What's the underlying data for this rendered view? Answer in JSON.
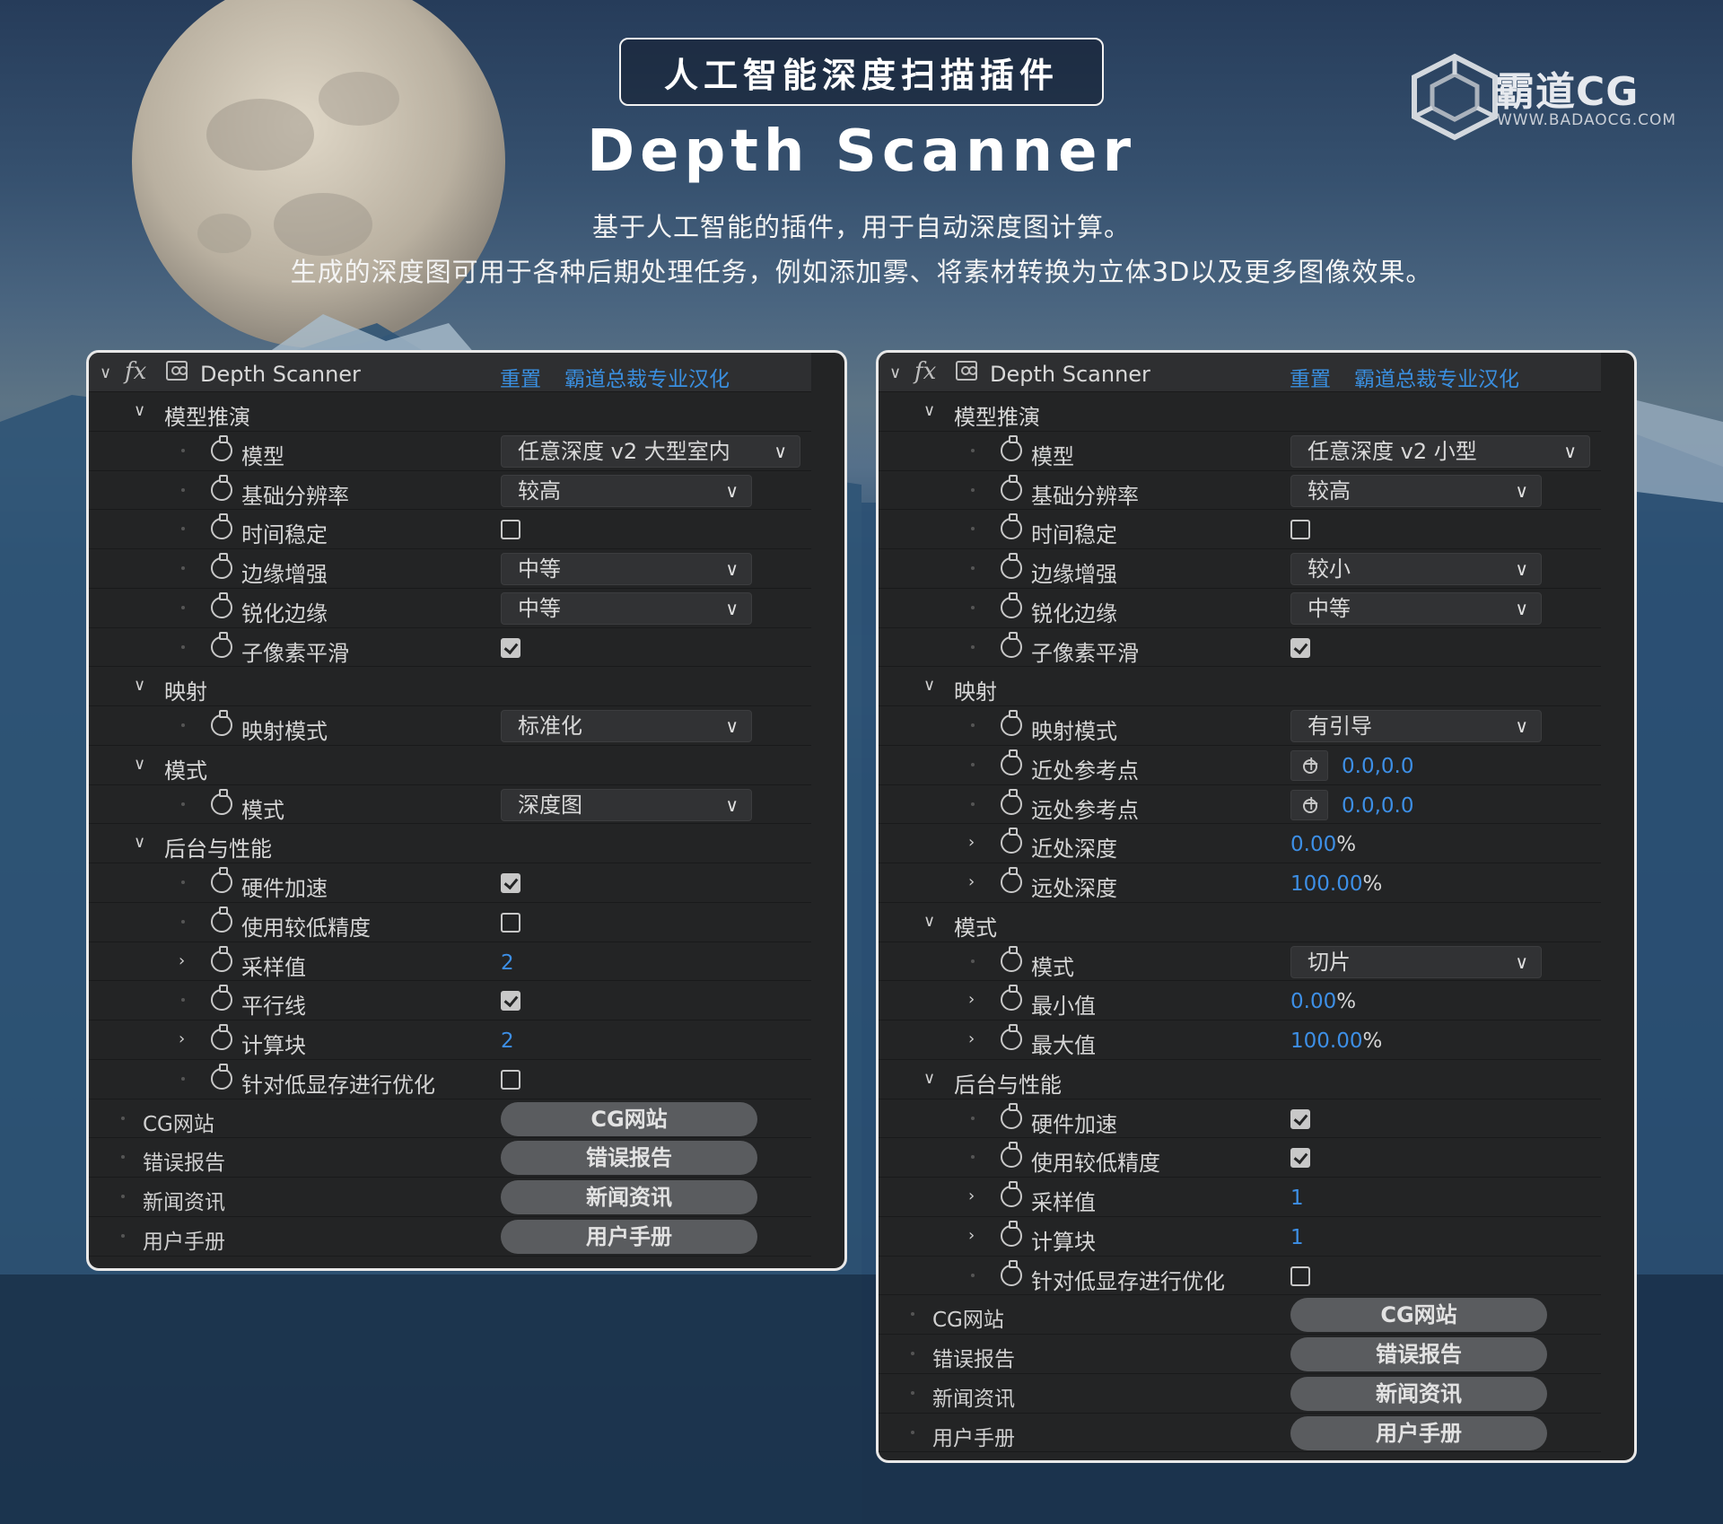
{
  "header": {
    "badge": "人工智能深度扫描插件",
    "title": "Depth Scanner",
    "subtitle_1": "基于人工智能的插件，用于自动深度图计算。",
    "subtitle_2": "生成的深度图可用于各种后期处理任务，例如添加雾、将素材转换为立体3D以及更多图像效果。"
  },
  "logo": {
    "name": "霸道CG",
    "url": "WWW.BADAOCG.COM"
  },
  "colors": {
    "accent_blue": "#3a8fe0",
    "panel_bg": "#232425",
    "button_bg": "#5a5c5f"
  },
  "left_panel": {
    "effect_name": "Depth Scanner",
    "reset": "重置",
    "localization": "霸道总裁专业汉化",
    "groups": {
      "model": "模型推演",
      "mapping": "映射",
      "mode": "模式",
      "backend": "后台与性能"
    },
    "params": {
      "model": {
        "label": "模型",
        "value": "任意深度 v2 大型室内"
      },
      "base_res": {
        "label": "基础分辨率",
        "value": "较高"
      },
      "temporal": {
        "label": "时间稳定",
        "checked": false
      },
      "edge_enhance": {
        "label": "边缘增强",
        "value": "中等"
      },
      "sharpen_edges": {
        "label": "锐化边缘",
        "value": "中等"
      },
      "subpixel": {
        "label": "子像素平滑",
        "checked": true
      },
      "map_mode": {
        "label": "映射模式",
        "value": "标准化"
      },
      "mode": {
        "label": "模式",
        "value": "深度图"
      },
      "hw_accel": {
        "label": "硬件加速",
        "checked": true
      },
      "low_precision": {
        "label": "使用较低精度",
        "checked": false
      },
      "samples": {
        "label": "采样值",
        "value": "2"
      },
      "parallel": {
        "label": "平行线",
        "checked": true
      },
      "tiles": {
        "label": "计算块",
        "value": "2"
      },
      "low_vram": {
        "label": "针对低显存进行优化",
        "checked": false
      }
    },
    "buttons": [
      {
        "label": "CG网站",
        "button": "CG网站"
      },
      {
        "label": "错误报告",
        "button": "错误报告"
      },
      {
        "label": "新闻资讯",
        "button": "新闻资讯"
      },
      {
        "label": "用户手册",
        "button": "用户手册"
      }
    ]
  },
  "right_panel": {
    "effect_name": "Depth Scanner",
    "reset": "重置",
    "localization": "霸道总裁专业汉化",
    "groups": {
      "model": "模型推演",
      "mapping": "映射",
      "mode": "模式",
      "backend": "后台与性能"
    },
    "params": {
      "model": {
        "label": "模型",
        "value": "任意深度 v2 小型"
      },
      "base_res": {
        "label": "基础分辨率",
        "value": "较高"
      },
      "temporal": {
        "label": "时间稳定",
        "checked": false
      },
      "edge_enhance": {
        "label": "边缘增强",
        "value": "较小"
      },
      "sharpen_edges": {
        "label": "锐化边缘",
        "value": "中等"
      },
      "subpixel": {
        "label": "子像素平滑",
        "checked": true
      },
      "map_mode": {
        "label": "映射模式",
        "value": "有引导"
      },
      "near_point": {
        "label": "近处参考点",
        "value": "0.0,0.0"
      },
      "far_point": {
        "label": "远处参考点",
        "value": "0.0,0.0"
      },
      "near_depth": {
        "label": "近处深度",
        "value": "0.00",
        "unit": "%"
      },
      "far_depth": {
        "label": "远处深度",
        "value": "100.00",
        "unit": "%"
      },
      "mode": {
        "label": "模式",
        "value": "切片"
      },
      "min": {
        "label": "最小值",
        "value": "0.00",
        "unit": "%"
      },
      "max": {
        "label": "最大值",
        "value": "100.00",
        "unit": "%"
      },
      "hw_accel": {
        "label": "硬件加速",
        "checked": true
      },
      "low_precision": {
        "label": "使用较低精度",
        "checked": true
      },
      "samples": {
        "label": "采样值",
        "value": "1"
      },
      "tiles": {
        "label": "计算块",
        "value": "1"
      },
      "low_vram": {
        "label": "针对低显存进行优化",
        "checked": false
      }
    },
    "buttons": [
      {
        "label": "CG网站",
        "button": "CG网站"
      },
      {
        "label": "错误报告",
        "button": "错误报告"
      },
      {
        "label": "新闻资讯",
        "button": "新闻资讯"
      },
      {
        "label": "用户手册",
        "button": "用户手册"
      }
    ]
  }
}
